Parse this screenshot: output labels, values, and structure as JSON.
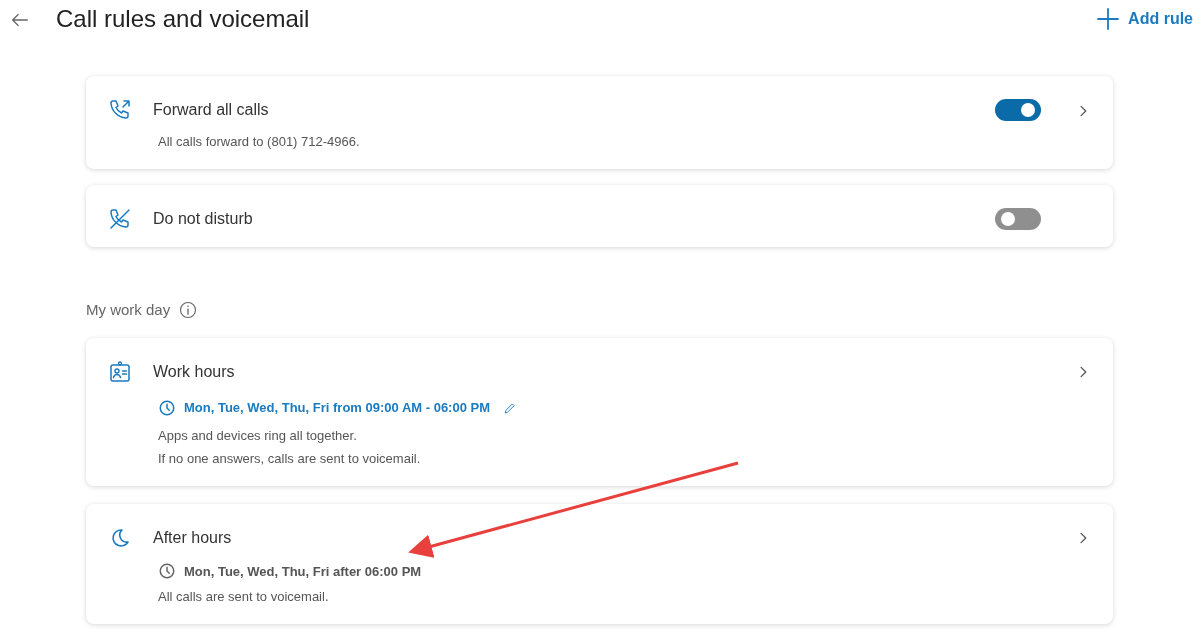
{
  "header": {
    "title": "Call rules and voicemail",
    "add_button": "Add rule"
  },
  "rules": [
    {
      "title": "Forward all calls",
      "toggle": {
        "on": true
      },
      "chevron": true,
      "description": [
        "All calls forward to (801) 712-4966."
      ]
    },
    {
      "title": "Do not disturb",
      "toggle": {
        "on": false
      },
      "chevron": false
    }
  ],
  "section": {
    "label": "My work day"
  },
  "workday_rules": [
    {
      "title": "Work hours",
      "chevron": true,
      "schedule": {
        "text": "Mon, Tue, Wed, Thu, Fri from 09:00 AM - 06:00 PM",
        "active": true,
        "editable": true
      },
      "description": [
        "Apps and devices ring all together.",
        "If no one answers, calls are sent to voicemail."
      ]
    },
    {
      "title": "After hours",
      "chevron": true,
      "schedule": {
        "text": "Mon, Tue, Wed, Thu, Fri after 06:00 PM",
        "active": false,
        "editable": false
      },
      "description": [
        "All calls are sent to voicemail."
      ]
    }
  ]
}
